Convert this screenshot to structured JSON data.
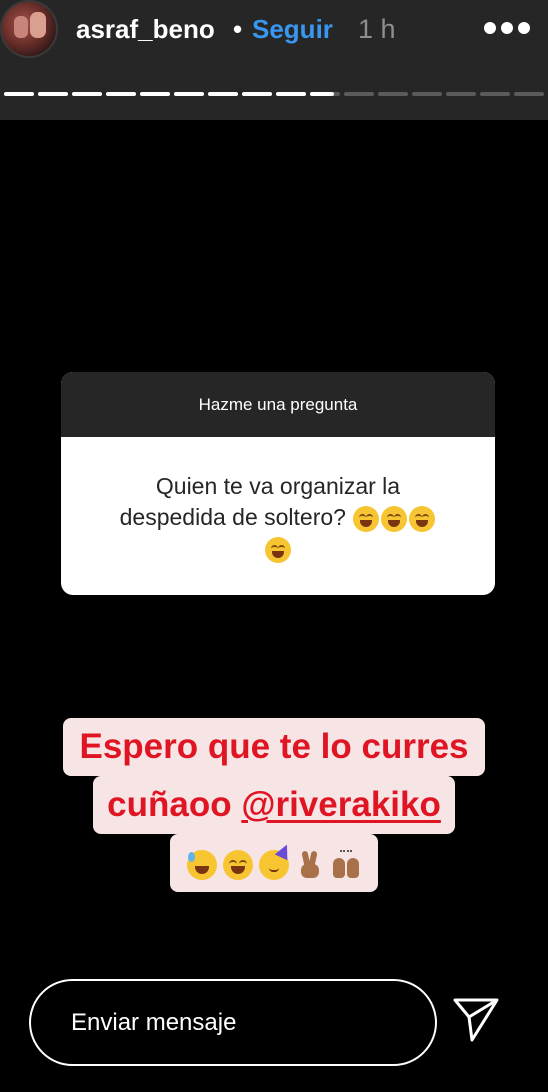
{
  "header": {
    "username": "asraf_beno",
    "separator": "•",
    "follow_label": "Seguir",
    "time": "1 h",
    "more_icon": "more-horizontal-icon"
  },
  "progress": {
    "total_segments": 16,
    "completed_segments": 9,
    "current_segment_progress": 0.8,
    "active_color": "#ffffff",
    "inactive_color": "#5a5a5a"
  },
  "question_sticker": {
    "title": "Hazme una pregunta",
    "line1": "Quien te va organizar la",
    "line2": "despedida de soltero?"
  },
  "caption": {
    "line1": "Espero que te lo curres",
    "line2_text": "cuñaoo",
    "mention": "@riverakiko",
    "color": "#e01524",
    "background": "#f7e4e4"
  },
  "reply": {
    "placeholder": "Enviar mensaje",
    "send_icon": "send-paper-plane-icon"
  }
}
